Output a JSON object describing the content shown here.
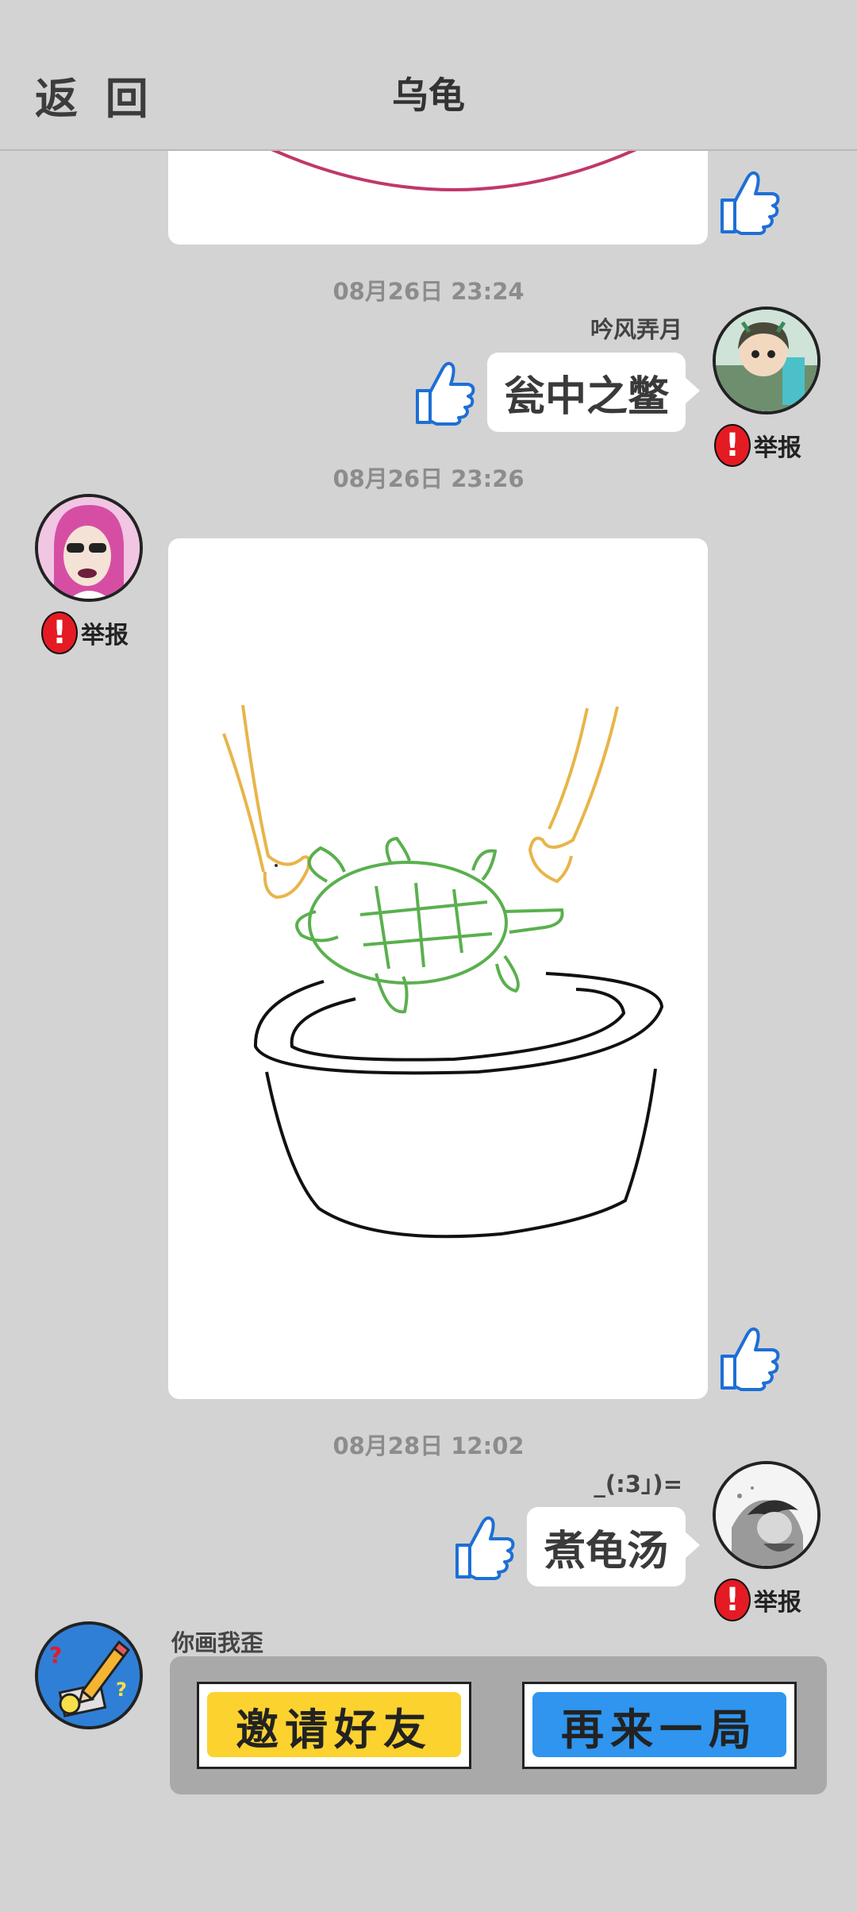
{
  "header": {
    "back_label": "返 回",
    "title": "乌龟"
  },
  "messages": [
    {
      "time": "08月26日  23:24",
      "nickname": "吟风弄月",
      "text": "瓮中之鳖",
      "report_label": "举报"
    },
    {
      "time": "08月26日  23:26",
      "report_label": "举报"
    },
    {
      "time": "08月28日  12:02",
      "nickname": "_(:3」)=",
      "text": "煮龟汤",
      "report_label": "举报"
    }
  ],
  "system": {
    "name": "你画我歪",
    "invite_label": "邀请好友",
    "again_label": "再来一局"
  },
  "colors": {
    "background": "#d3d3d3",
    "report_red": "#e51b23",
    "thumb_blue": "#1d6fd6",
    "invite_yellow": "#fcd22f",
    "again_blue": "#2f95ef"
  },
  "icons": [
    "thumb-up-icon",
    "warning-icon"
  ]
}
